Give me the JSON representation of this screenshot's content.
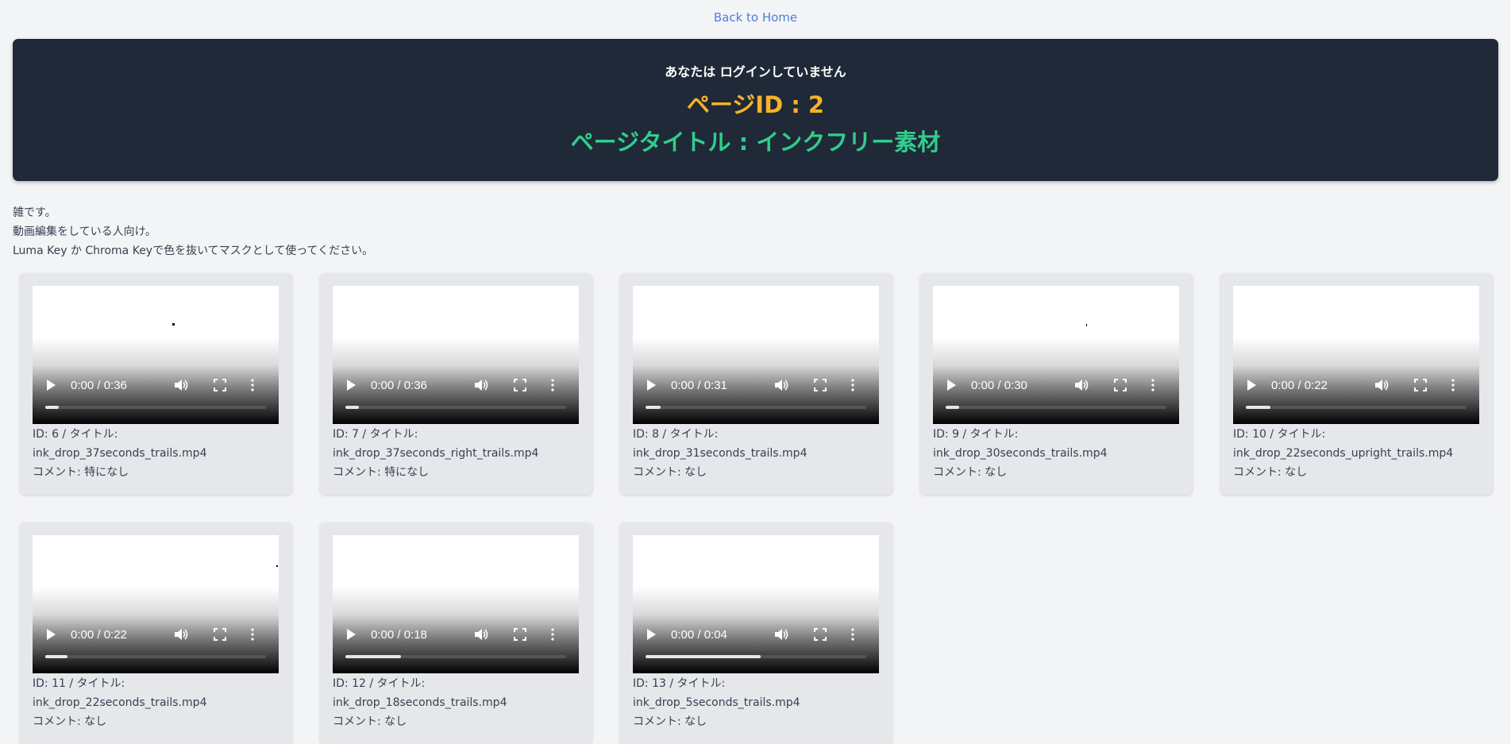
{
  "nav": {
    "back_link": "Back to Home"
  },
  "header": {
    "login_status": "あなたは ログインしていません",
    "page_id": "ページID : 2",
    "page_title": "ページタイトル : インクフリー素材"
  },
  "description": {
    "lines": [
      "雑です。",
      "動画編集をしている人向け。",
      "Luma Key か Chroma Keyで色を抜いてマスクとして使ってください。"
    ]
  },
  "videos": [
    {
      "time": "0:00 / 0:36",
      "progress": 0.06,
      "id_line": "ID: 6 / タイトル:",
      "filename": "ink_drop_37seconds_trails.mp4",
      "comment": "コメント: 特になし"
    },
    {
      "time": "0:00 / 0:36",
      "progress": 0.06,
      "id_line": "ID: 7 / タイトル:",
      "filename": "ink_drop_37seconds_right_trails.mp4",
      "comment": "コメント: 特になし"
    },
    {
      "time": "0:00 / 0:31",
      "progress": 0.07,
      "id_line": "ID: 8 / タイトル:",
      "filename": "ink_drop_31seconds_trails.mp4",
      "comment": "コメント: なし"
    },
    {
      "time": "0:00 / 0:30",
      "progress": 0.06,
      "id_line": "ID: 9 / タイトル:",
      "filename": "ink_drop_30seconds_trails.mp4",
      "comment": "コメント: なし"
    },
    {
      "time": "0:00 / 0:22",
      "progress": 0.11,
      "id_line": "ID: 10 / タイトル:",
      "filename": "ink_drop_22seconds_upright_trails.mp4",
      "comment": "コメント: なし"
    },
    {
      "time": "0:00 / 0:22",
      "progress": 0.1,
      "id_line": "ID: 11 / タイトル:",
      "filename": "ink_drop_22seconds_trails.mp4",
      "comment": "コメント: なし"
    },
    {
      "time": "0:00 / 0:18",
      "progress": 0.25,
      "id_line": "ID: 12 / タイトル:",
      "filename": "ink_drop_18seconds_trails.mp4",
      "comment": "コメント: なし"
    },
    {
      "time": "0:00 / 0:04",
      "progress": 0.52,
      "id_line": "ID: 13 / タイトル:",
      "filename": "ink_drop_5seconds_trails.mp4",
      "comment": "コメント: なし"
    }
  ],
  "colors": {
    "header_bg": "#1f2937",
    "page_id": "#f5b22a",
    "page_title": "#2fce8d",
    "link": "#4f7fd6",
    "card_bg": "#e5e7eb"
  }
}
